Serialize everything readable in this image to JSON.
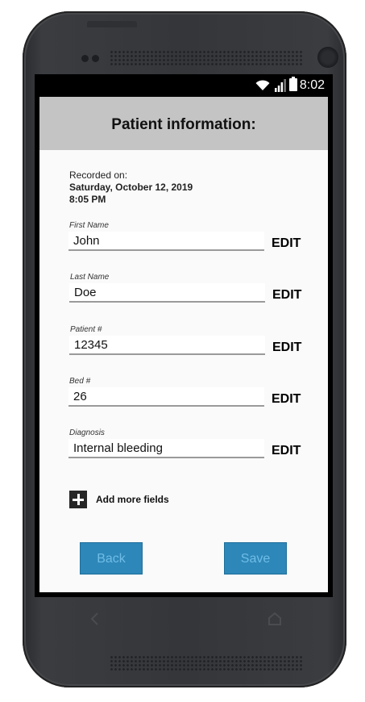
{
  "statusbar": {
    "time": "8:02"
  },
  "header": {
    "title": "Patient information:"
  },
  "recorded": {
    "label": "Recorded on:",
    "date": "Saturday, October 12, 2019",
    "time": "8:05 PM"
  },
  "fields": [
    {
      "label": "First Name",
      "value": "John",
      "action": "EDIT"
    },
    {
      "label": "Last Name",
      "value": "Doe",
      "action": "EDIT"
    },
    {
      "label": "Patient #",
      "value": "12345",
      "action": "EDIT"
    },
    {
      "label": "Bed #",
      "value": "26",
      "action": "EDIT"
    },
    {
      "label": "Diagnosis",
      "value": "Internal bleeding",
      "action": "EDIT"
    }
  ],
  "add_more": {
    "label": "Add more fields"
  },
  "buttons": {
    "back": "Back",
    "save": "Save"
  },
  "colors": {
    "header_bg": "#c4c4c4",
    "button_bg": "#2d87b8",
    "button_text": "#6fbde7"
  }
}
